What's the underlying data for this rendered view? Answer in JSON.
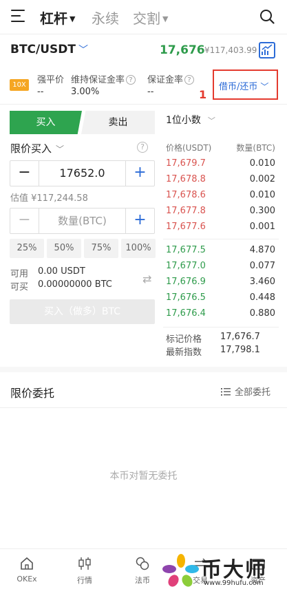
{
  "nav": {
    "tabs": [
      {
        "label": "杠杆",
        "active": true,
        "has_dropdown": true
      },
      {
        "label": "永续",
        "active": false,
        "has_dropdown": false
      },
      {
        "label": "交割",
        "active": false,
        "has_dropdown": true
      }
    ],
    "menu_icon": "hamburger-menu-icon",
    "search_icon": "search-icon"
  },
  "pair": {
    "symbol": "BTC/USDT",
    "last_price": "17,676",
    "cny_price": "¥117,403.99"
  },
  "margin_info": {
    "leverage": "10X",
    "items": [
      {
        "label": "强平价",
        "value": "--",
        "help": false
      },
      {
        "label": "维持保证金率",
        "value": "3.00%",
        "help": true
      },
      {
        "label": "保证金率",
        "value": "--",
        "help": true
      }
    ],
    "borrow_repay": "借币/还币",
    "annotation": "1"
  },
  "trade": {
    "buy_tab": "买入",
    "sell_tab": "卖出",
    "order_type": "限价买入",
    "price_value": "17652.0",
    "valuation": "估值 ¥117,244.58",
    "amount_placeholder": "数量(BTC)",
    "percents": [
      "25%",
      "50%",
      "75%",
      "100%"
    ],
    "available_label": "可用",
    "available_value": "0.00 USDT",
    "buyable_label": "可买",
    "buyable_value": "0.00000000 BTC",
    "submit": "买入（做多）BTC"
  },
  "orderbook": {
    "precision": "1位小数",
    "price_header": "价格(USDT)",
    "qty_header": "数量(BTC)",
    "asks": [
      {
        "price": "17,679.7",
        "qty": "0.010"
      },
      {
        "price": "17,678.8",
        "qty": "0.002"
      },
      {
        "price": "17,678.6",
        "qty": "0.010"
      },
      {
        "price": "17,677.8",
        "qty": "0.300"
      },
      {
        "price": "17,677.6",
        "qty": "0.001"
      }
    ],
    "bids": [
      {
        "price": "17,677.5",
        "qty": "4.870"
      },
      {
        "price": "17,677.0",
        "qty": "0.077"
      },
      {
        "price": "17,676.9",
        "qty": "3.460"
      },
      {
        "price": "17,676.5",
        "qty": "0.448"
      },
      {
        "price": "17,676.4",
        "qty": "0.880"
      }
    ],
    "mark_price_label": "标记价格",
    "mark_price": "17,676.7",
    "index_label": "最新指数",
    "index_price": "17,798.1"
  },
  "orders": {
    "title": "限价委托",
    "all_orders": "全部委托",
    "empty": "本币对暂无委托"
  },
  "bottom_nav": [
    {
      "label": "OKEx",
      "icon": "home-icon"
    },
    {
      "label": "行情",
      "icon": "candlestick-icon"
    },
    {
      "label": "法币",
      "icon": "fiat-coins-icon"
    },
    {
      "label": "交易",
      "icon": "trade-icon"
    },
    {
      "label": "资产",
      "icon": "wallet-icon"
    }
  ],
  "watermark": {
    "title": "币大师",
    "url": "www.99hufu.com"
  },
  "colors": {
    "buy_green": "#2ea44f",
    "price_green": "#2e9b4b",
    "ask_red": "#d9534f",
    "accent_blue": "#2b6bd7",
    "annotation_red": "#e43a2e",
    "leverage_orange": "#f5a623"
  }
}
